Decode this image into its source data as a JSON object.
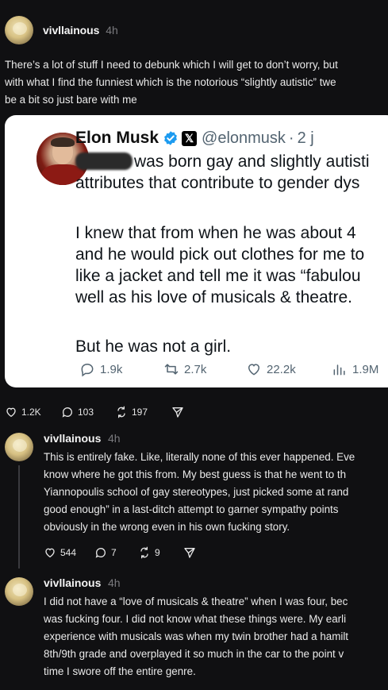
{
  "post": {
    "username": "vivllainous",
    "time": "4h",
    "lines": [
      "There’s a lot of stuff I need to debunk which I will get to don’t worry, but",
      "with what I find the funniest which is the notorious “slightly autistic” twe",
      "be a bit so just bare with me"
    ]
  },
  "tweet": {
    "name": "Elon Musk",
    "handle": "@elonmusk",
    "separator": "·",
    "time": "2 j",
    "line1_rest": "was born gay and slightly autisti",
    "line2": "attributes that contribute to gender dys",
    "para2": [
      "I knew that from when he was about 4",
      "and he would pick out clothes for me to",
      "like a jacket and tell me it was “fabulou",
      "well as his love of musicals & theatre."
    ],
    "para3": "But he was not a girl.",
    "actions": {
      "replies": "1.9k",
      "reposts": "2.7k",
      "likes": "22.2k",
      "views": "1.9M"
    }
  },
  "post_engagement": {
    "likes": "1.2K",
    "replies": "103",
    "reposts": "197"
  },
  "replies": [
    {
      "username": "vivllainous",
      "time": "4h",
      "lines": [
        "This is entirely fake. Like, literally none of this ever happened. Eve",
        "know where he got this from. My best guess is that he went to th",
        "Yiannopoulis school of gay stereotypes, just picked some at rand",
        "good enough” in a last-ditch attempt to garner sympathy points",
        "obviously in the wrong even in his own fucking story."
      ],
      "likes": "544",
      "replies_count": "7",
      "reposts": "9"
    },
    {
      "username": "vivllainous",
      "time": "4h",
      "lines": [
        "I did not have a “love of musicals & theatre” when I was four, bec",
        "was fucking four. I did not know what these things were. My earli",
        "experience with musicals was when my twin brother had a hamilt",
        "8th/9th grade and overplayed it so much in the car to the point v",
        "time I swore off the entire genre."
      ]
    }
  ],
  "icons": {
    "verified_color": "#1d9bf0",
    "tweet_icon_color": "#536471"
  }
}
